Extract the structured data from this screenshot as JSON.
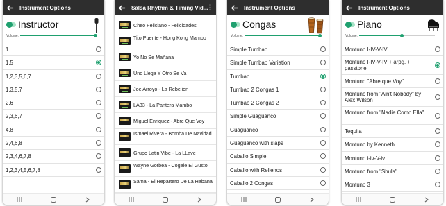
{
  "screens": [
    {
      "title": "Instrument Options",
      "instrument": "Instructor",
      "volume_label": "Volume:",
      "volume_level": 0.98,
      "options": [
        {
          "label": "1",
          "selected": false
        },
        {
          "label": "1,5",
          "selected": true
        },
        {
          "label": "1,2,3,5,6,7",
          "selected": false
        },
        {
          "label": "1,3,5,7",
          "selected": false
        },
        {
          "label": "2,6",
          "selected": false
        },
        {
          "label": "2,3,6,7",
          "selected": false
        },
        {
          "label": "4,8",
          "selected": false
        },
        {
          "label": "2,4,6,8",
          "selected": false
        },
        {
          "label": "2,3,4,6,7,8",
          "selected": false
        },
        {
          "label": "1,2,3,4,5,6,7,8",
          "selected": false
        }
      ]
    },
    {
      "title": "Salsa Rhythm & Timing Vid...",
      "more_icon": "more-vert-icon",
      "songs": [
        "Cheo Feliciano - Felicidades",
        "Tito Puente - Hong Kong Mambo",
        "Yo No Se Mañana",
        "Uno Llega Y Otro Se Va",
        "Joe Arroyo - La Rebelion",
        "LA33 - La Pantera Mambo",
        "Miguel Enriquez - Abre Que Voy",
        "Ismael Rivera - Bomba De Navidad",
        "Grupo Latin Vibe - La LLave",
        "Wayne Gorbea - Cogele El Gusto",
        "Sama - El Repartero De La Habana"
      ]
    },
    {
      "title": "Instrument Options",
      "instrument": "Congas",
      "volume_label": "Volume:",
      "volume_level": 0.98,
      "options": [
        {
          "label": "Simple Tumbao",
          "selected": false
        },
        {
          "label": "Simple Tumbao Variation",
          "selected": false
        },
        {
          "label": "Tumbao",
          "selected": true
        },
        {
          "label": "Tumbao 2 Congas 1",
          "selected": false
        },
        {
          "label": "Tumbao 2 Congas 2",
          "selected": false
        },
        {
          "label": "Simple Guaguancó",
          "selected": false
        },
        {
          "label": "Guaguancó",
          "selected": false
        },
        {
          "label": "Guaguancó with slaps",
          "selected": false
        },
        {
          "label": "Caballo Simple",
          "selected": false
        },
        {
          "label": "Caballo with Rellenos",
          "selected": false
        },
        {
          "label": "Caballo 2 Congas",
          "selected": false
        }
      ]
    },
    {
      "title": "Instrument Options",
      "instrument": "Piano",
      "volume_label": "Volume:",
      "volume_level": 0.72,
      "options": [
        {
          "label": "Montuno I-IV-V-IV",
          "selected": false
        },
        {
          "label": "Montuno I-IV-V-IV + arpg. + passtone",
          "selected": true
        },
        {
          "label": "Montuno \"Abre que Voy\"",
          "selected": false
        },
        {
          "label": "Montuno from \"Ain't Nobody\" by Alex Wilson",
          "selected": false
        },
        {
          "label": "Montuno from \"Nadie Como Ella\"",
          "selected": false
        },
        {
          "label": "Tequila",
          "selected": false
        },
        {
          "label": "Montuno by Kenneth",
          "selected": false
        },
        {
          "label": "Montuno i-iv-V-iv",
          "selected": false
        },
        {
          "label": "Montuno from \"Shula\"",
          "selected": false
        },
        {
          "label": "Montuno 3",
          "selected": false
        }
      ]
    }
  ],
  "colors": {
    "appbar": "#2e2e2e",
    "accent": "#1fa06f",
    "divider": "#e3e3e3"
  },
  "icons": [
    "back-arrow-icon",
    "microphone-icon",
    "conga-drums-icon",
    "grand-piano-icon",
    "recent-apps-icon",
    "home-icon",
    "back-icon"
  ]
}
